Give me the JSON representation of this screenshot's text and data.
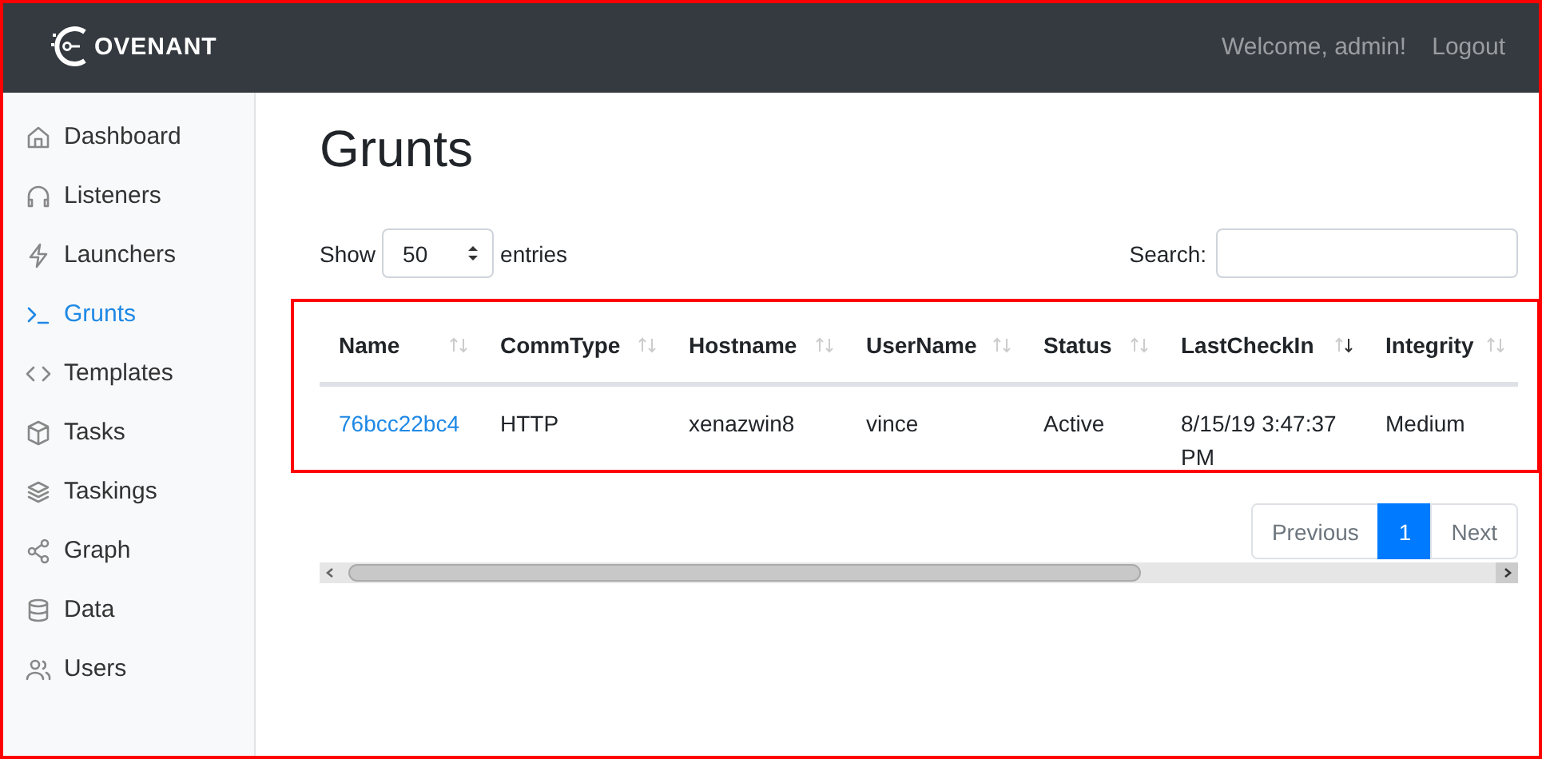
{
  "header": {
    "logo_text": "OVENANT",
    "welcome": "Welcome, admin!",
    "logout": "Logout"
  },
  "sidebar": {
    "items": [
      {
        "label": "Dashboard",
        "selected": false
      },
      {
        "label": "Listeners",
        "selected": false
      },
      {
        "label": "Launchers",
        "selected": false
      },
      {
        "label": "Grunts",
        "selected": true
      },
      {
        "label": "Templates",
        "selected": false
      },
      {
        "label": "Tasks",
        "selected": false
      },
      {
        "label": "Taskings",
        "selected": false
      },
      {
        "label": "Graph",
        "selected": false
      },
      {
        "label": "Data",
        "selected": false
      },
      {
        "label": "Users",
        "selected": false
      }
    ]
  },
  "page": {
    "title": "Grunts"
  },
  "length": {
    "before": "Show",
    "value": "50",
    "after": "entries"
  },
  "search": {
    "label": "Search:"
  },
  "table": {
    "columns": [
      {
        "label": "Name",
        "sorted": false
      },
      {
        "label": "CommType",
        "sorted": false
      },
      {
        "label": "Hostname",
        "sorted": false
      },
      {
        "label": "UserName",
        "sorted": false
      },
      {
        "label": "Status",
        "sorted": false
      },
      {
        "label": "LastCheckIn",
        "sorted": true
      },
      {
        "label": "Integrity",
        "sorted": false
      }
    ],
    "rows": [
      [
        "76bcc22bc4",
        "HTTP",
        "xenazwin8",
        "vince",
        "Active",
        "8/15/19 3:47:37 PM",
        "Medium"
      ]
    ]
  },
  "pagination": [
    {
      "label": "Previous",
      "selected": false,
      "disabled": true
    },
    {
      "label": "1",
      "selected": true,
      "disabled": false
    },
    {
      "label": "Next",
      "selected": false,
      "disabled": true
    }
  ],
  "annotations": {
    "page_frame": true,
    "table_frame": true
  }
}
